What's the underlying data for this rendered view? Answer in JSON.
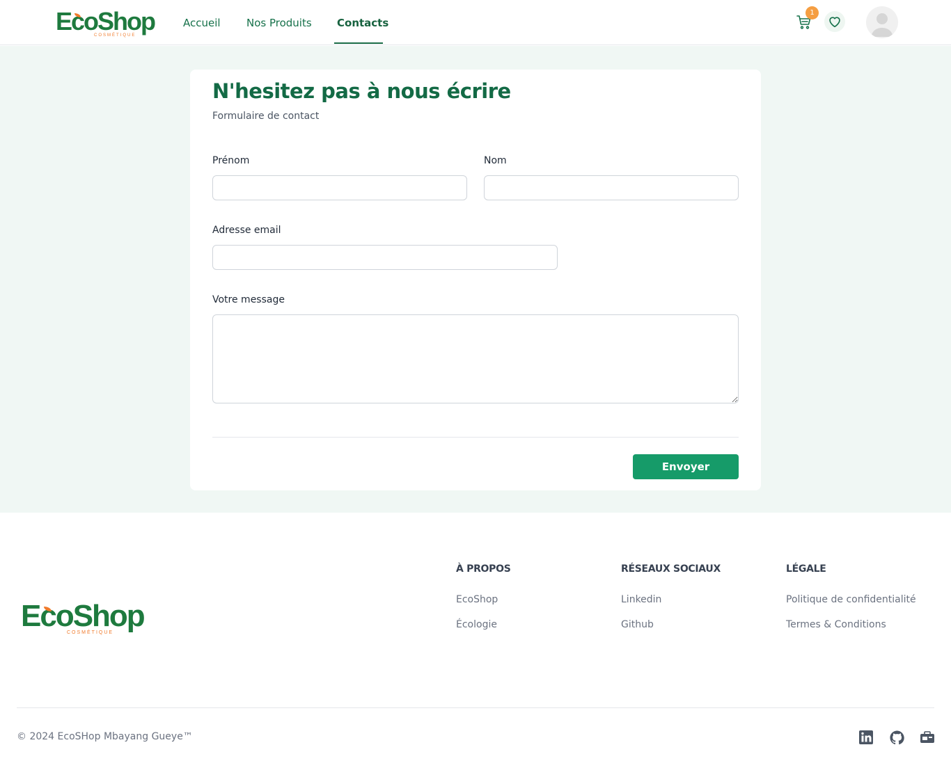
{
  "brand": {
    "name_part1": "Eco",
    "name_part2": "Shop",
    "tagline": "COSMÉTIQUE"
  },
  "nav": {
    "items": [
      {
        "label": "Accueil"
      },
      {
        "label": "Nos Produits"
      },
      {
        "label": "Contacts",
        "active": true
      }
    ]
  },
  "header": {
    "cart_count": "1",
    "icons": [
      "cart-icon",
      "heart-icon",
      "user-avatar"
    ]
  },
  "contact_form": {
    "title": "N'hesitez pas à nous écrire",
    "subtitle": "Formulaire de contact",
    "first_name_label": "Prénom",
    "first_name_value": "",
    "last_name_label": "Nom",
    "last_name_value": "",
    "email_label": "Adresse email",
    "email_value": "",
    "message_label": "Votre message",
    "message_value": "",
    "submit_label": "Envoyer"
  },
  "footer": {
    "columns": [
      {
        "heading": "À PROPOS",
        "links": [
          "EcoShop",
          "Écologie"
        ]
      },
      {
        "heading": "RÉSEAUX SOCIAUX",
        "links": [
          "Linkedin",
          "Github"
        ]
      },
      {
        "heading": "LÉGALE",
        "links": [
          "Politique de confidentialité",
          "Termes & Conditions"
        ]
      }
    ],
    "copyright": "© 2024 EcoSHop Mbayang Gueye™",
    "social_icons": [
      "linkedin-icon",
      "github-icon",
      "portfolio-icon"
    ]
  },
  "colors": {
    "primary": "#169b69",
    "brand_green": "#1e7a3e",
    "accent_orange": "#f07a2b",
    "page_bg": "#f0f7f4"
  }
}
